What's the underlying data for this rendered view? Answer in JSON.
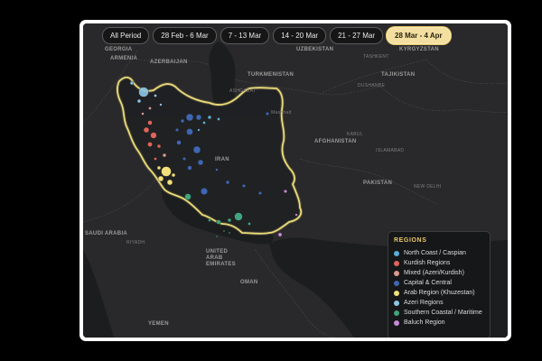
{
  "period_tabs": [
    {
      "label": "All Period",
      "active": false
    },
    {
      "label": "28 Feb - 6 Mar",
      "active": false
    },
    {
      "label": "7 - 13 Mar",
      "active": false
    },
    {
      "label": "14 - 20 Mar",
      "active": false
    },
    {
      "label": "21 - 27 Mar",
      "active": false
    },
    {
      "label": "28 Mar - 4 Apr",
      "active": true
    }
  ],
  "map_labels": {
    "georgia": "GEORGIA",
    "armenia": "ARMENIA",
    "azerbaijan": "AZERBAIJAN",
    "uzbekistan": "UZBEKISTAN",
    "tajikistan": "TAJIKISTAN",
    "kyrgyzstan": "KYRGYZSTAN",
    "turkmenistan": "TURKMENISTAN",
    "tashkent": "TASHKENT",
    "dushanbe": "DUSHANBE",
    "ashgabat": "ASHGABAT",
    "mashhad": "Mashhad",
    "afghanistan": "AFGHANISTAN",
    "kabul": "KABUL",
    "islamabad": "ISLAMABAD",
    "iran": "IRAN",
    "pakistan": "PAKISTAN",
    "new_delhi": "NEW DELHI",
    "saudi_arabia": "SAUDI ARABIA",
    "riyadh": "RIYADH",
    "uae": "UNITED ARAB EMIRATES",
    "oman": "OMAN",
    "yemen": "YEMEN"
  },
  "legend": {
    "title": "REGIONS",
    "items": [
      {
        "label": "North Coast / Caspian",
        "color": "#5aaed6"
      },
      {
        "label": "Kurdish Regions",
        "color": "#e0645a"
      },
      {
        "label": "Mixed (Azeri/Kurdish)",
        "color": "#d99a8e"
      },
      {
        "label": "Capital & Central",
        "color": "#3f66b0"
      },
      {
        "label": "Arab Region (Khuzestan)",
        "color": "#f2e07a"
      },
      {
        "label": "Azeri Regions",
        "color": "#8ec6e6"
      },
      {
        "label": "Southern Coastal / Maritime",
        "color": "#3fa57e"
      },
      {
        "label": "Baluch Region",
        "color": "#c78ad6"
      }
    ]
  },
  "colors": {
    "border": "#f0e07c",
    "land": "#27282a",
    "water": "#1b1c1e"
  }
}
